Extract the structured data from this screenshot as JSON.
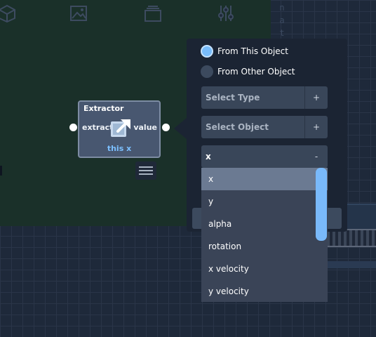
{
  "node": {
    "title": "Extractor",
    "input_label": "extract",
    "output_label": "value",
    "subtitle": "this x",
    "icon": "external-link-icon"
  },
  "panel": {
    "source_options": [
      {
        "label": "From This Object",
        "selected": true
      },
      {
        "label": "From Other Object",
        "selected": false
      }
    ],
    "type_field": {
      "placeholder": "Select Type",
      "button": "+"
    },
    "object_field": {
      "placeholder": "Select Object",
      "button": "+"
    },
    "value_field": {
      "value": "x",
      "button": "-"
    }
  },
  "dropdown": {
    "options": [
      "x",
      "y",
      "alpha",
      "rotation",
      "x velocity",
      "y velocity"
    ],
    "selected": "x"
  },
  "toolbar": {
    "items": [
      {
        "icon": "cube-icon"
      },
      {
        "icon": "image-icon"
      },
      {
        "icon": "layers-icon"
      },
      {
        "icon": "sliders-icon"
      }
    ]
  },
  "colors": {
    "accent": "#78bcfb",
    "canvas": "#1a3029",
    "panel": "#1b2433",
    "node": "#485770"
  }
}
